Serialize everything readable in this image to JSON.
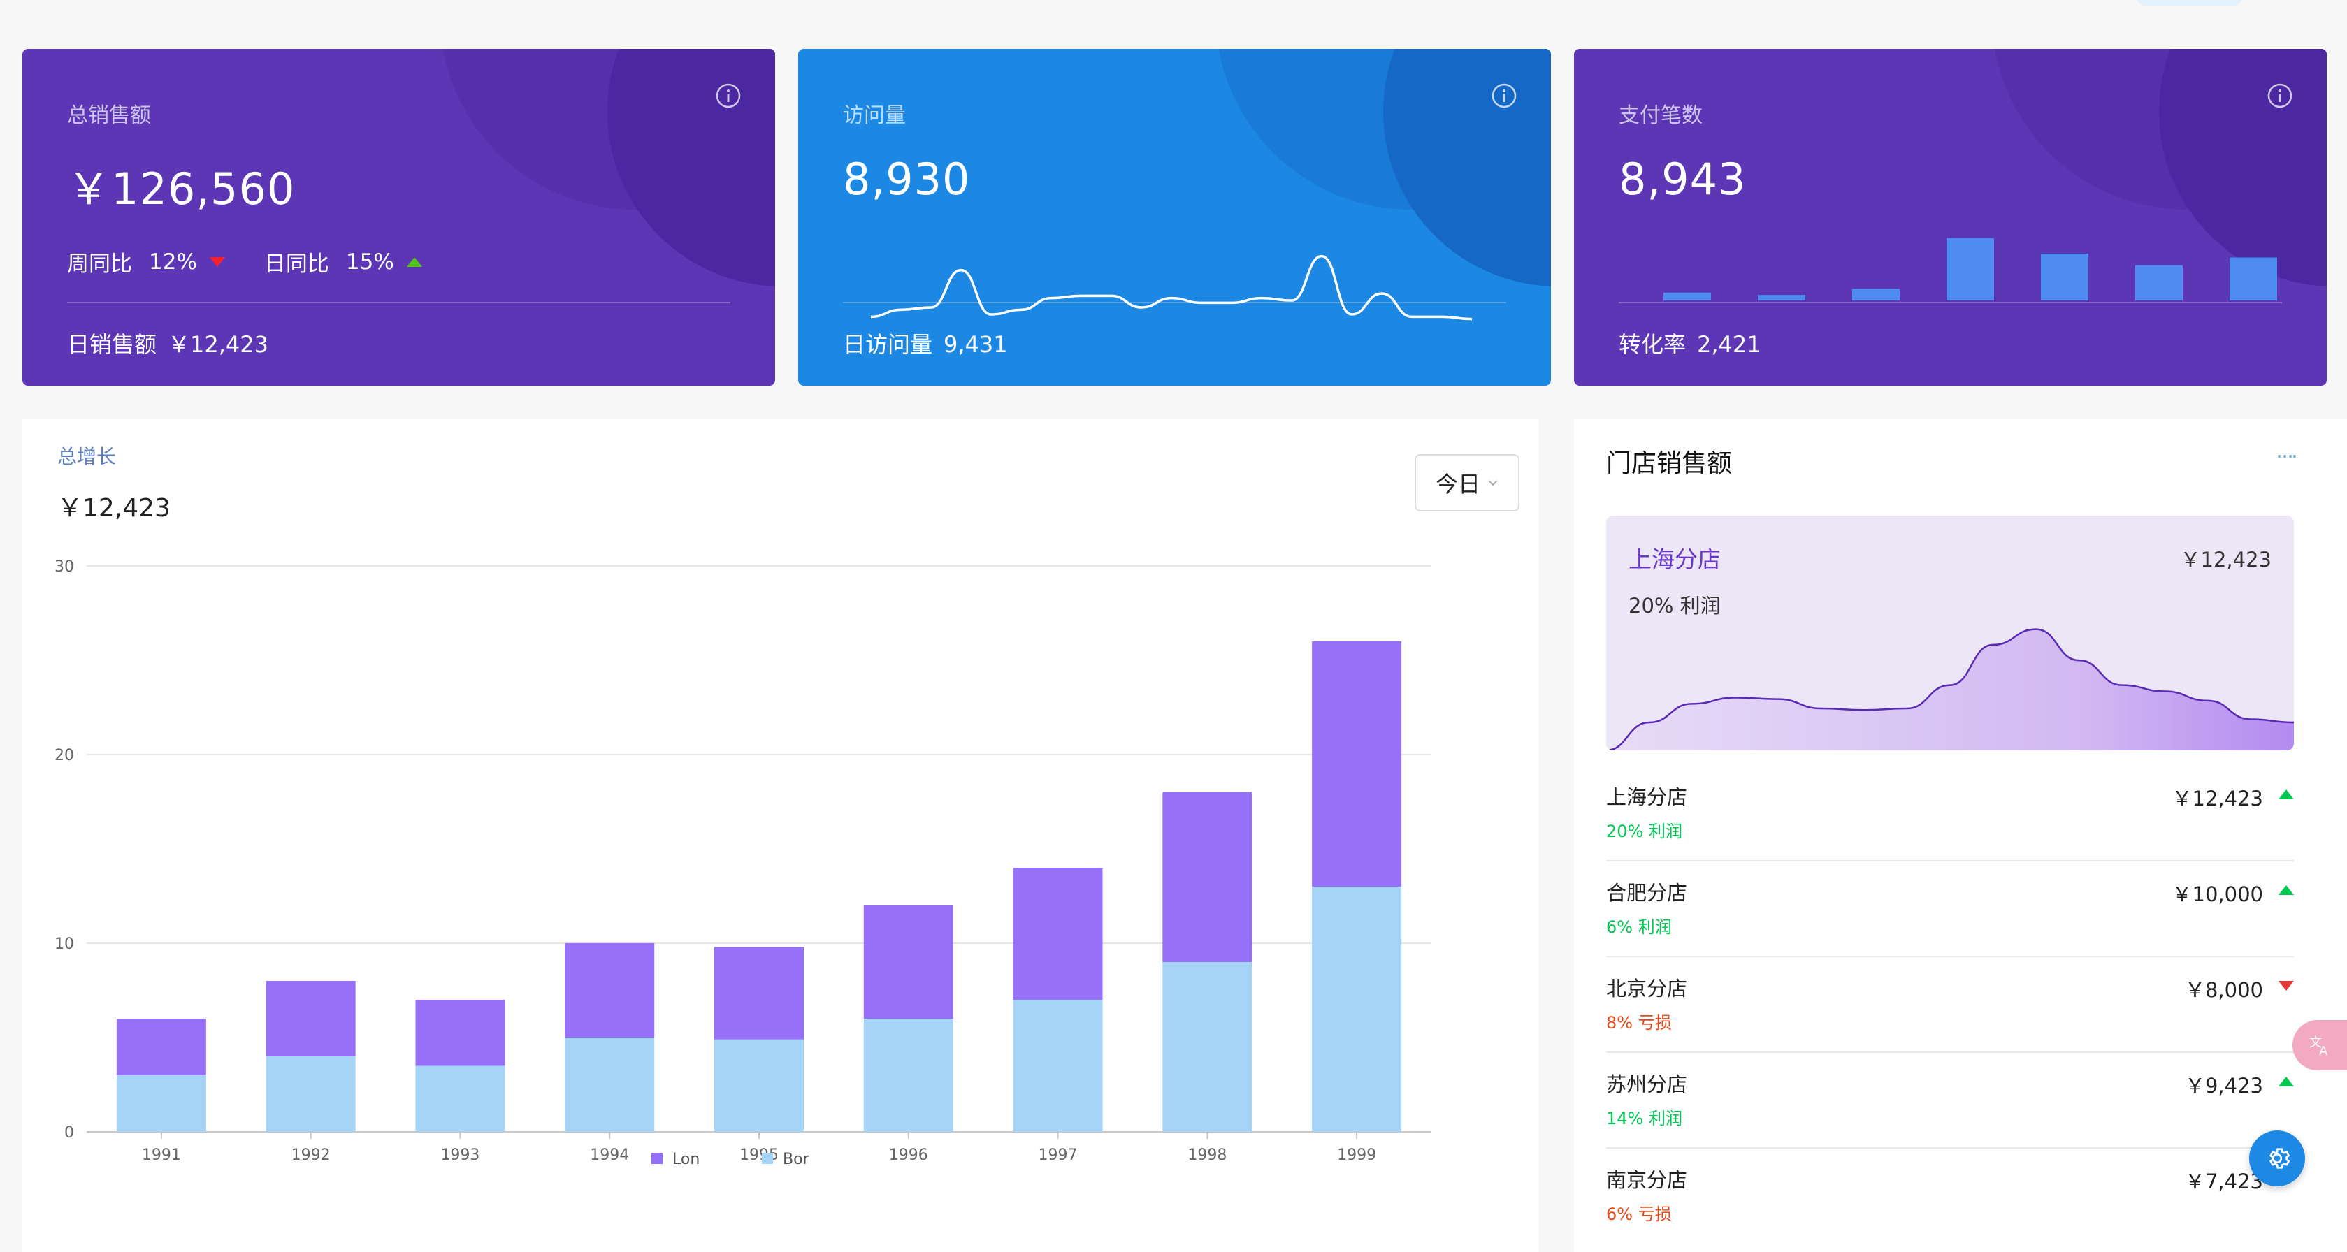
{
  "cards": [
    {
      "label": "总销售额",
      "value": "￥126,560",
      "trends": [
        {
          "label": "周同比",
          "value": "12%",
          "direction": "down"
        },
        {
          "label": "日同比",
          "value": "15%",
          "direction": "up"
        }
      ],
      "footer_label": "日销售额",
      "footer_value": "￥12,423",
      "icon": "info-icon"
    },
    {
      "label": "访问量",
      "value": "8,930",
      "footer_label": "日访问量",
      "footer_value": "9,431",
      "icon": "info-icon",
      "sparkline": [
        2,
        5,
        6,
        22,
        3,
        5,
        10,
        11,
        11,
        6,
        10,
        8,
        8,
        10,
        9,
        28,
        3,
        12,
        2,
        2,
        1
      ]
    },
    {
      "label": "支付笔数",
      "value": "8,943",
      "footer_label": "转化率",
      "footer_value": "2,421",
      "icon": "info-icon",
      "bars": [
        1,
        0.7,
        1.5,
        8,
        6,
        4.5,
        5.5
      ]
    }
  ],
  "growth": {
    "label": "总增长",
    "value": "￥12,423",
    "period_select": "今日"
  },
  "chart_data": {
    "type": "bar",
    "stacked": true,
    "categories": [
      "1991",
      "1992",
      "1993",
      "1994",
      "1995",
      "1996",
      "1997",
      "1998",
      "1999"
    ],
    "series": [
      {
        "name": "Bor",
        "values": [
          3,
          4,
          3.5,
          5,
          4.9,
          6,
          7,
          9,
          13
        ],
        "color": "#a5d4f7"
      },
      {
        "name": "Lon",
        "values": [
          3,
          4,
          3.5,
          5,
          4.9,
          6,
          7,
          9,
          13
        ],
        "color": "#9670f8"
      }
    ],
    "legend": [
      "Lon",
      "Bor"
    ],
    "legend_position": "bottom",
    "ylim": [
      0,
      30
    ],
    "yticks": [
      "0",
      "10",
      "20",
      "30"
    ],
    "grid": true
  },
  "stores": {
    "title": "门店销售额",
    "featured": {
      "name": "上海分店",
      "value": "￥12,423",
      "sub": "20% 利润",
      "curve": [
        0,
        18,
        30,
        34,
        33,
        27,
        26,
        27,
        42,
        68,
        78,
        58,
        42,
        38,
        32,
        20,
        18
      ]
    },
    "list": [
      {
        "name": "上海分店",
        "value": "￥12,423",
        "sub": "20% 利润",
        "direction": "up"
      },
      {
        "name": "合肥分店",
        "value": "￥10,000",
        "sub": "6% 利润",
        "direction": "up"
      },
      {
        "name": "北京分店",
        "value": "￥8,000",
        "sub": "8% 亏损",
        "direction": "down"
      },
      {
        "name": "苏州分店",
        "value": "￥9,423",
        "sub": "14% 利润",
        "direction": "up"
      },
      {
        "name": "南京分店",
        "value": "￥7,423",
        "sub": "6% 亏损",
        "direction": "down"
      }
    ]
  },
  "floating": {
    "translate_icon": "translate-icon",
    "settings_icon": "gear-icon"
  },
  "colors": {
    "purple_card": "#5c36b5",
    "blue_card": "#1d87e4",
    "up": "#00c853",
    "down": "#e53935",
    "bar_lon": "#9670f8",
    "bar_bor": "#a5d4f7"
  }
}
